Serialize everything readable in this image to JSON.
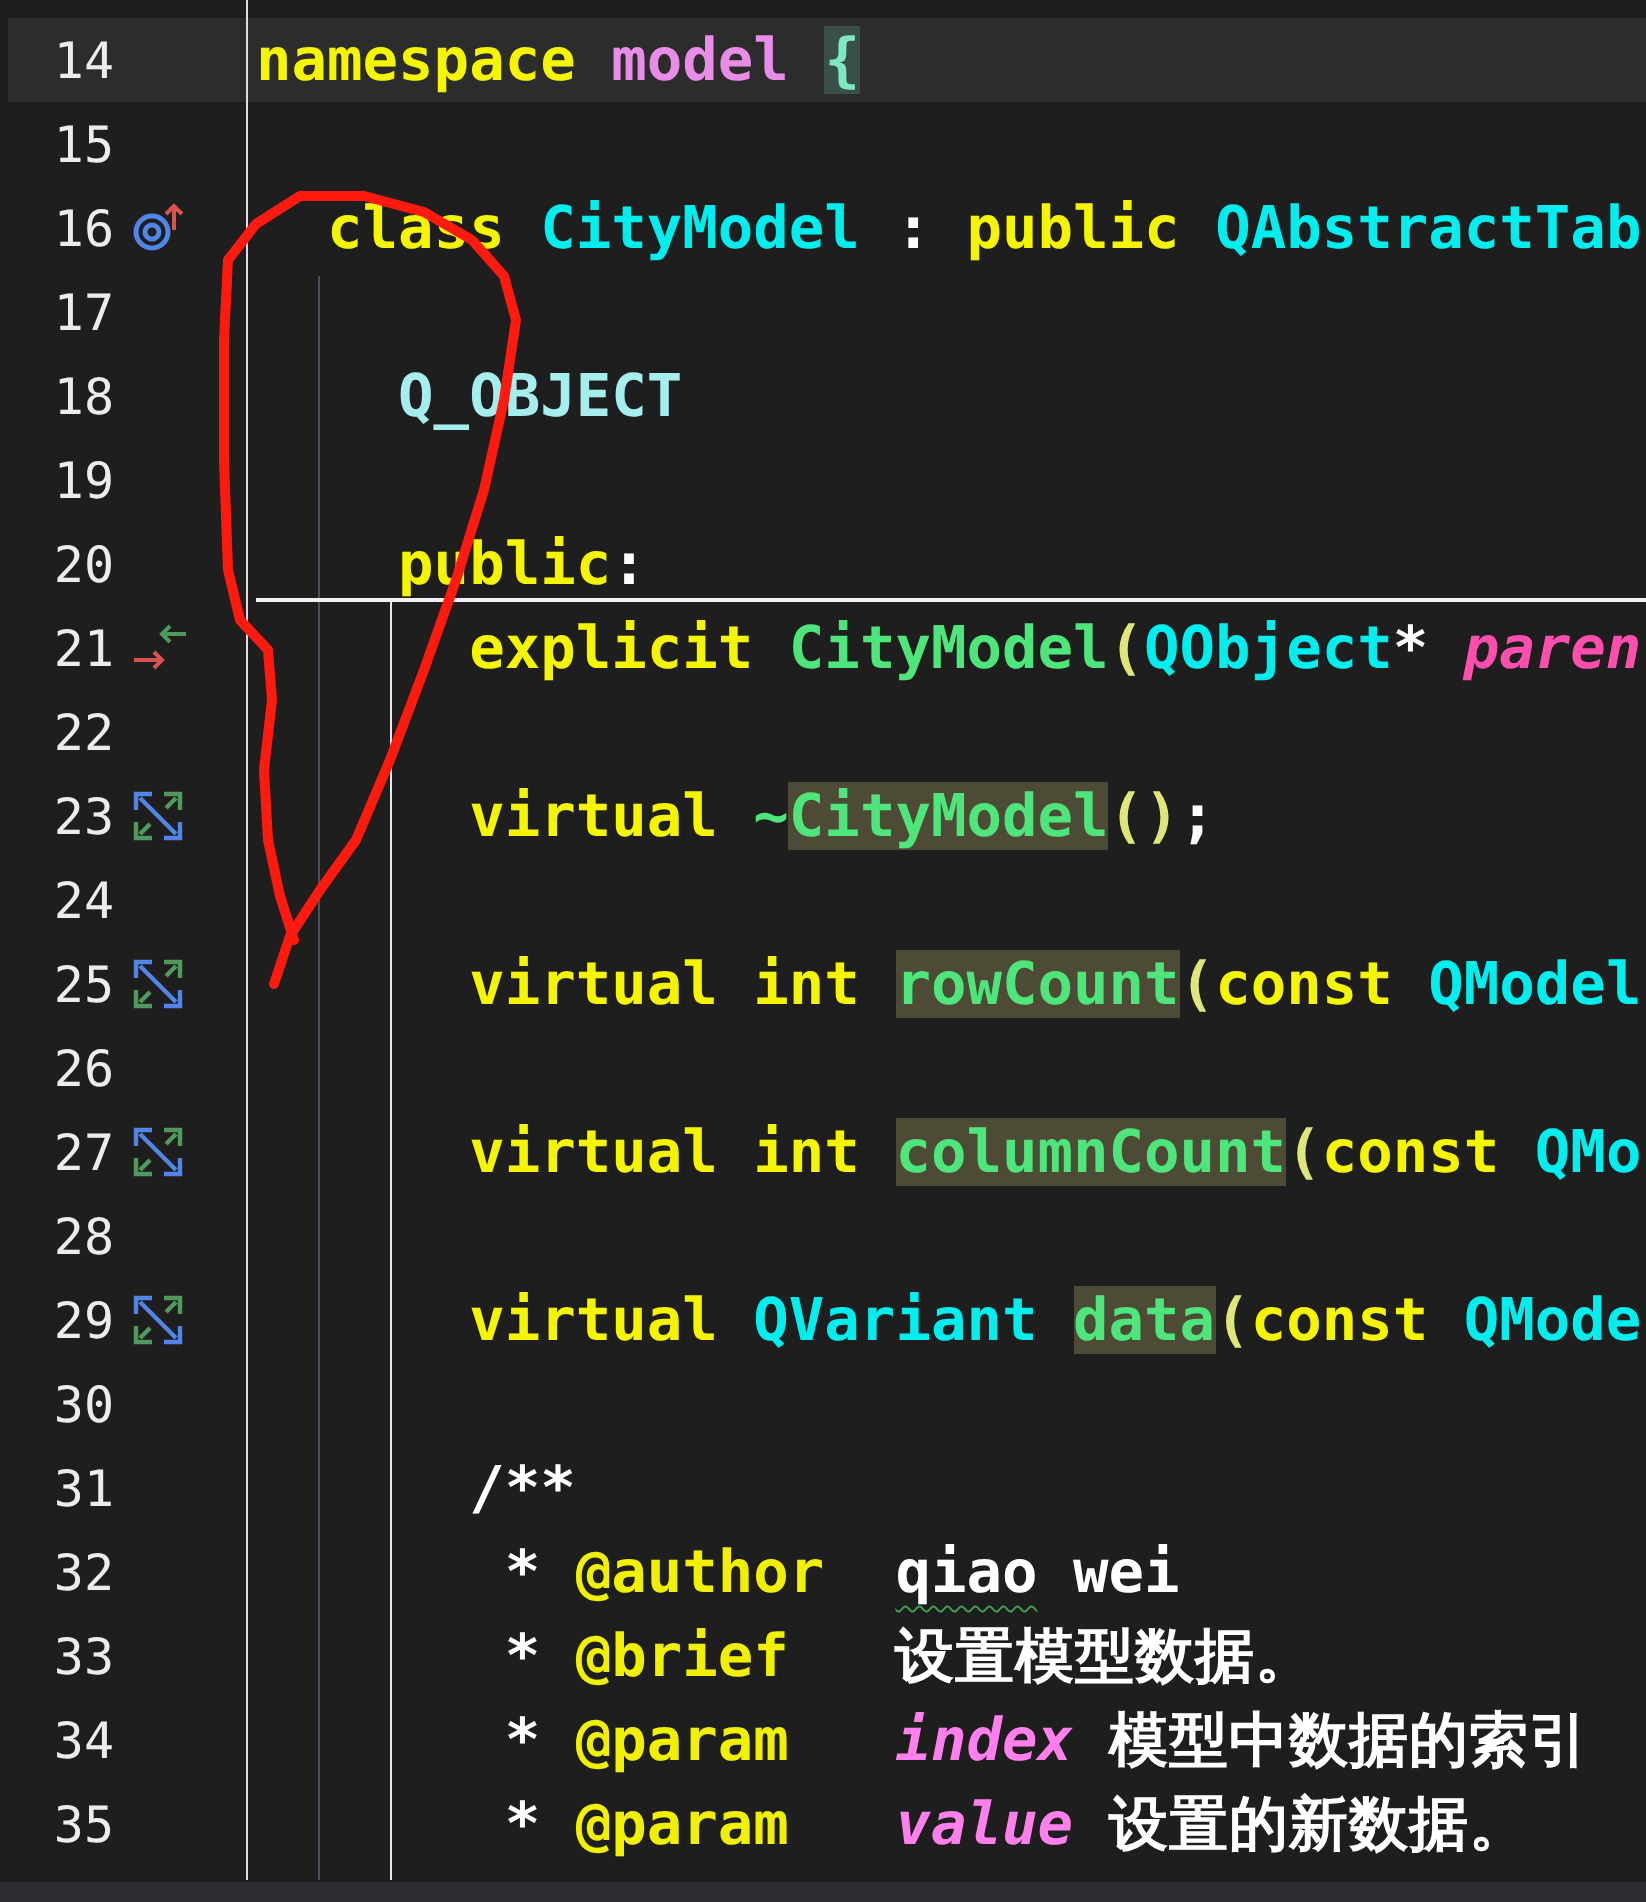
{
  "editor": {
    "lines": [
      {
        "number": "14",
        "current": true,
        "kind": "plain",
        "tokens": [
          {
            "text": "namespace",
            "kind": "kw",
            "highlighted": false
          },
          {
            "text": " model ",
            "kind": "ns",
            "highlighted": false
          },
          {
            "text": "{",
            "kind": "brace",
            "highlighted": true
          }
        ]
      },
      {
        "number": "15",
        "current": false,
        "kind": "plain"
      },
      {
        "number": "16",
        "current": false,
        "kind": "override",
        "tokens": [
          {
            "text": "  class",
            "kind": "kw",
            "highlighted": false
          },
          {
            "text": " CityModel",
            "kind": "type",
            "highlighted": false
          },
          {
            "text": " : ",
            "kind": "punct",
            "highlighted": false
          },
          {
            "text": "public",
            "kind": "kw",
            "highlighted": false
          },
          {
            "text": " QAbstractTab",
            "kind": "type",
            "highlighted": false
          }
        ]
      },
      {
        "number": "17",
        "current": false,
        "kind": "plain"
      },
      {
        "number": "18",
        "current": false,
        "kind": "plain",
        "tokens": [
          {
            "text": "    Q_OBJECT",
            "kind": "macro",
            "highlighted": false
          }
        ]
      },
      {
        "number": "19",
        "current": false,
        "kind": "plain"
      },
      {
        "number": "20",
        "current": false,
        "kind": "plain",
        "tokens": [
          {
            "text": "    public",
            "kind": "kw",
            "highlighted": false
          },
          {
            "text": ":",
            "kind": "punct",
            "highlighted": false
          }
        ]
      },
      {
        "number": "21",
        "current": false,
        "kind": "swap",
        "tokens": [
          {
            "text": "      explicit",
            "kind": "kw",
            "highlighted": false
          },
          {
            "text": " CityModel",
            "kind": "func",
            "highlighted": false
          },
          {
            "text": "(",
            "kind": "paren",
            "highlighted": false
          },
          {
            "text": "QObject",
            "kind": "type",
            "highlighted": false
          },
          {
            "text": "*",
            "kind": "punct",
            "highlighted": false
          },
          {
            "text": " paren",
            "kind": "param",
            "highlighted": false
          }
        ]
      },
      {
        "number": "22",
        "current": false,
        "kind": "plain"
      },
      {
        "number": "23",
        "current": false,
        "kind": "expand",
        "tokens": [
          {
            "text": "      virtual",
            "kind": "kw",
            "highlighted": false
          },
          {
            "text": " ~",
            "kind": "func",
            "highlighted": false
          },
          {
            "text": "CityModel",
            "kind": "func",
            "highlighted": true
          },
          {
            "text": "()",
            "kind": "paren",
            "highlighted": false
          },
          {
            "text": ";",
            "kind": "punct",
            "highlighted": false
          }
        ]
      },
      {
        "number": "24",
        "current": false,
        "kind": "plain"
      },
      {
        "number": "25",
        "current": false,
        "kind": "expand",
        "tokens": [
          {
            "text": "      virtual int ",
            "kind": "kw",
            "highlighted": false
          },
          {
            "text": "rowCount",
            "kind": "func",
            "highlighted": true
          },
          {
            "text": "(",
            "kind": "paren",
            "highlighted": false
          },
          {
            "text": "const",
            "kind": "kw",
            "highlighted": false
          },
          {
            "text": " QModel",
            "kind": "type",
            "highlighted": false
          }
        ]
      },
      {
        "number": "26",
        "current": false,
        "kind": "plain"
      },
      {
        "number": "27",
        "current": false,
        "kind": "expand",
        "tokens": [
          {
            "text": "      virtual int ",
            "kind": "kw",
            "highlighted": false
          },
          {
            "text": "columnCount",
            "kind": "func",
            "highlighted": true
          },
          {
            "text": "(",
            "kind": "paren",
            "highlighted": false
          },
          {
            "text": "const",
            "kind": "kw",
            "highlighted": false
          },
          {
            "text": " QMo",
            "kind": "type",
            "highlighted": false
          }
        ]
      },
      {
        "number": "28",
        "current": false,
        "kind": "plain"
      },
      {
        "number": "29",
        "current": false,
        "kind": "expand",
        "tokens": [
          {
            "text": "      virtual",
            "kind": "kw",
            "highlighted": false
          },
          {
            "text": " QVariant ",
            "kind": "type",
            "highlighted": false
          },
          {
            "text": "data",
            "kind": "func",
            "highlighted": true
          },
          {
            "text": "(",
            "kind": "paren",
            "highlighted": false
          },
          {
            "text": "const",
            "kind": "kw",
            "highlighted": false
          },
          {
            "text": " QMode",
            "kind": "type",
            "highlighted": false
          }
        ]
      },
      {
        "number": "30",
        "current": false,
        "kind": "plain"
      },
      {
        "number": "31",
        "current": false,
        "kind": "plain",
        "tokens": [
          {
            "text": "      /**",
            "kind": "text",
            "highlighted": false
          }
        ]
      },
      {
        "number": "32",
        "current": false,
        "kind": "plain",
        "tokens": [
          {
            "text": "       * ",
            "kind": "text",
            "highlighted": false
          },
          {
            "text": "@author  ",
            "kind": "tag",
            "highlighted": false
          },
          {
            "text": "qiao",
            "kind": "text",
            "highlighted": false,
            "misspelled": true
          },
          {
            "text": " wei",
            "kind": "text",
            "highlighted": false,
            "misspelled": false
          }
        ]
      },
      {
        "number": "33",
        "current": false,
        "kind": "plain",
        "tokens": [
          {
            "text": "       * ",
            "kind": "text",
            "highlighted": false
          },
          {
            "text": "@brief",
            "kind": "tag",
            "highlighted": false
          },
          {
            "text": "   设置模型数据。",
            "kind": "text",
            "highlighted": false
          }
        ]
      },
      {
        "number": "34",
        "current": false,
        "kind": "plain",
        "tokens": [
          {
            "text": "       * ",
            "kind": "text",
            "highlighted": false
          },
          {
            "text": "@param   ",
            "kind": "tag",
            "highlighted": false
          },
          {
            "text": "index",
            "kind": "docparam",
            "highlighted": false
          },
          {
            "text": " 模型中数据的索引",
            "kind": "text",
            "highlighted": false
          }
        ]
      },
      {
        "number": "35",
        "current": false,
        "kind": "plain",
        "tokens": [
          {
            "text": "       * ",
            "kind": "text",
            "highlighted": false
          },
          {
            "text": "@param   ",
            "kind": "tag",
            "highlighted": false
          },
          {
            "text": "value",
            "kind": "docparam",
            "highlighted": false
          },
          {
            "text": " 设置的新数据。",
            "kind": "text",
            "highlighted": false
          }
        ]
      }
    ]
  },
  "ink_mark": {
    "kind": "loop"
  }
}
